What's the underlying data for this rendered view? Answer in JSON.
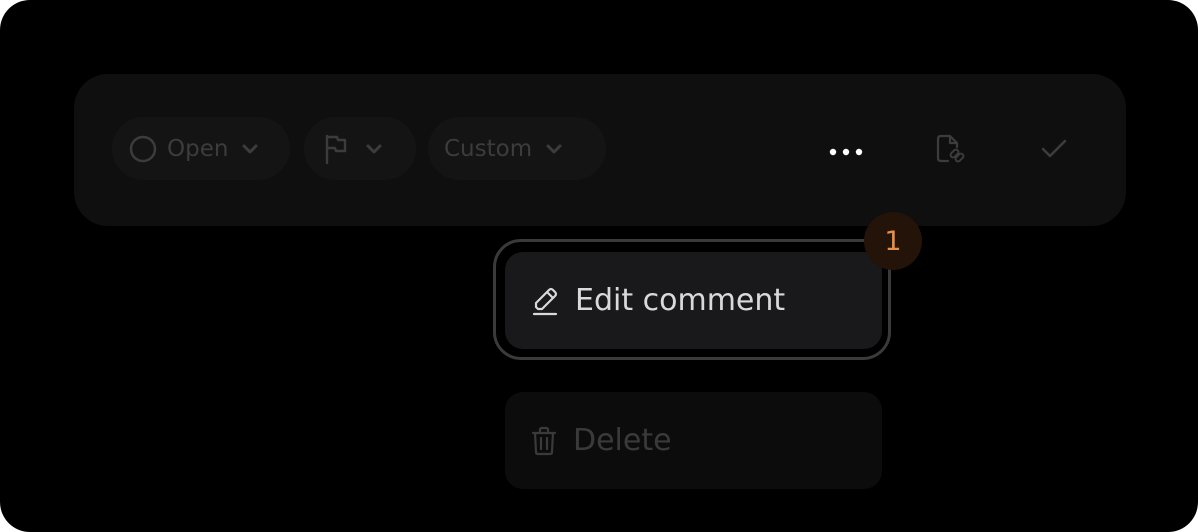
{
  "toolbar": {
    "status_label": "Open",
    "custom_label": "Custom",
    "icons": {
      "status": "circle-icon",
      "priority": "flag-icon",
      "more": "more-horizontal-icon",
      "attach": "file-link-icon",
      "resolve": "check-icon",
      "chevron": "chevron-down-icon"
    }
  },
  "menu": {
    "edit_label": "Edit comment",
    "delete_label": "Delete",
    "icons": {
      "edit": "pencil-icon",
      "delete": "trash-icon"
    }
  },
  "step_badge": "1",
  "colors": {
    "background": "#000000",
    "badge_text": "#e58f47",
    "badge_bg": "#241308",
    "active_text": "#d9d9d9",
    "dim_text": "#3a3a3a"
  }
}
